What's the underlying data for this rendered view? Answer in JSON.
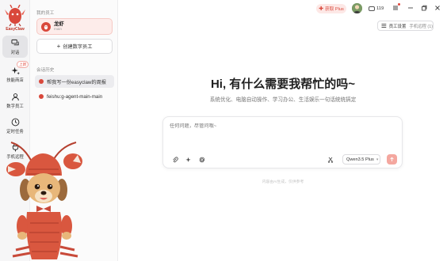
{
  "app": {
    "logo_text": "EasyClaw",
    "colors": {
      "accent": "#d9483b",
      "accent_light": "#fdecea",
      "send_button": "#f4a79f"
    }
  },
  "rail": {
    "items": [
      {
        "label": "对话",
        "icon": "chat-icon",
        "active": true
      },
      {
        "label": "技能商店",
        "icon": "sparkle-icon",
        "active": false,
        "badge": "上新"
      },
      {
        "label": "数字员工",
        "icon": "person-icon",
        "active": false
      },
      {
        "label": "定时任务",
        "icon": "clock-icon",
        "active": false
      },
      {
        "label": "手机远程",
        "icon": "plug-icon",
        "active": false
      }
    ]
  },
  "panel": {
    "employees_label": "我的员工",
    "employee": {
      "name": "龙虾",
      "sub": "main"
    },
    "create_label": "创建数字员工",
    "history_label": "会话历史",
    "history": [
      {
        "title": "帮我写一份easyclaw的周报",
        "active": true
      },
      {
        "title": "feishu:g-agent-main-main",
        "active": false
      }
    ]
  },
  "topbar": {
    "plus_label": "获取 Plus",
    "coins": "119",
    "settings_label": "员工设置",
    "settings_sub": "手机远程 (1)"
  },
  "main": {
    "title": "Hi, 有什么需要我帮忙的吗~",
    "subtitle": "系统优化、电脑自动操作、学习办公、生活娱乐一句话统统搞定",
    "input_placeholder": "任何问题，尽管问哦~",
    "model": "Qwen3.5 Plus",
    "disclaimer": "内容由AI生成，仅供参考"
  }
}
